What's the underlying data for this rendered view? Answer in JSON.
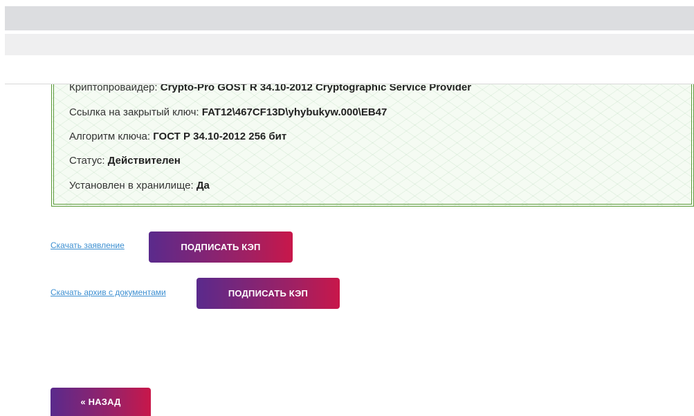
{
  "certificate": {
    "crypto_provider_label": "Криптопровайдер:",
    "crypto_provider_value": "Crypto-Pro GOST R 34.10-2012 Cryptographic Service Provider",
    "private_key_label": "Ссылка на закрытый ключ:",
    "private_key_value": "FAT12\\467CF13D\\yhybukyw.000\\EB47",
    "algorithm_label": "Алгоритм ключа:",
    "algorithm_value": "ГОСТ Р 34.10-2012 256 бит",
    "status_label": "Статус:",
    "status_value": "Действителен",
    "installed_label": "Установлен в хранилище:",
    "installed_value": "Да"
  },
  "actions": {
    "download_application_link": "Скачать заявление",
    "sign_kep_button_1": "ПОДПИСАТЬ КЭП",
    "download_archive_link": "Скачать архив с документами",
    "sign_kep_button_2": "ПОДПИСАТЬ КЭП"
  },
  "nav": {
    "back_button": "« НАЗАД"
  },
  "colors": {
    "card_border": "#5c9a3a",
    "link": "#3d8fd1",
    "button_gradient_start": "#5a2a8c",
    "button_gradient_end": "#c8174a"
  }
}
